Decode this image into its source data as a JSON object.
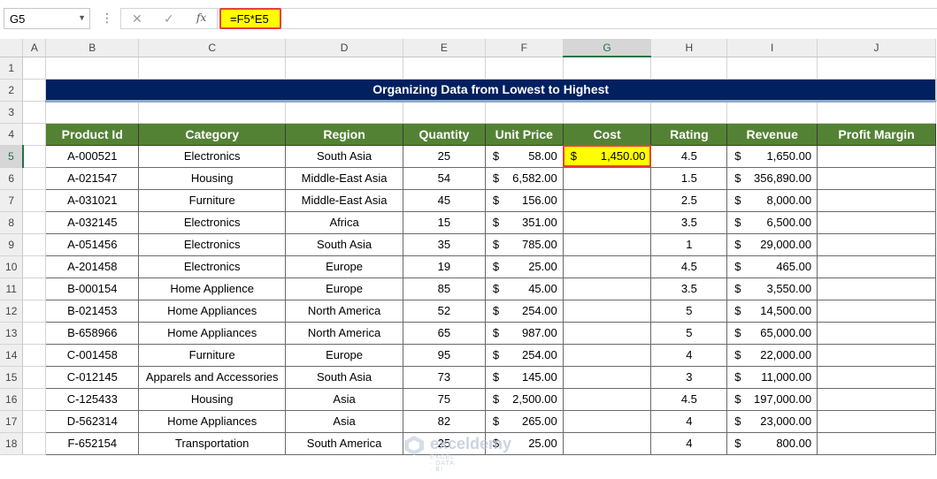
{
  "formula_bar": {
    "name_box": "G5",
    "formula": "=F5*E5",
    "cancel_glyph": "✕",
    "enter_glyph": "✓",
    "fx_label": "fx",
    "menu_glyph": "⋮"
  },
  "columns": [
    "A",
    "B",
    "C",
    "D",
    "E",
    "F",
    "G",
    "H",
    "I",
    "J"
  ],
  "rows": [
    "1",
    "2",
    "3",
    "4",
    "5",
    "6",
    "7",
    "8",
    "9",
    "10",
    "11",
    "12",
    "13",
    "14",
    "15",
    "16",
    "17",
    "18"
  ],
  "selected_cell": {
    "column": "G",
    "row": "5"
  },
  "title": "Organizing Data from Lowest to Highest",
  "headers": [
    "Product Id",
    "Category",
    "Region",
    "Quantity",
    "Unit Price",
    "Cost",
    "Rating",
    "Revenue",
    "Profit Margin"
  ],
  "currency_symbol": "$",
  "data_rows": [
    {
      "id": "A-000521",
      "category": "Electronics",
      "region": "South Asia",
      "qty": "25",
      "price": "58.00",
      "cost": "1,450.00",
      "rating": "4.5",
      "revenue": "1,650.00",
      "margin": ""
    },
    {
      "id": "A-021547",
      "category": "Housing",
      "region": "Middle-East Asia",
      "qty": "54",
      "price": "6,582.00",
      "cost": "",
      "rating": "1.5",
      "revenue": "356,890.00",
      "margin": ""
    },
    {
      "id": "A-031021",
      "category": "Furniture",
      "region": "Middle-East Asia",
      "qty": "45",
      "price": "156.00",
      "cost": "",
      "rating": "2.5",
      "revenue": "8,000.00",
      "margin": ""
    },
    {
      "id": "A-032145",
      "category": "Electronics",
      "region": "Africa",
      "qty": "15",
      "price": "351.00",
      "cost": "",
      "rating": "3.5",
      "revenue": "6,500.00",
      "margin": ""
    },
    {
      "id": "A-051456",
      "category": "Electronics",
      "region": "South Asia",
      "qty": "35",
      "price": "785.00",
      "cost": "",
      "rating": "1",
      "revenue": "29,000.00",
      "margin": ""
    },
    {
      "id": "A-201458",
      "category": "Electronics",
      "region": "Europe",
      "qty": "19",
      "price": "25.00",
      "cost": "",
      "rating": "4.5",
      "revenue": "465.00",
      "margin": ""
    },
    {
      "id": "B-000154",
      "category": "Home Applience",
      "region": "Europe",
      "qty": "85",
      "price": "45.00",
      "cost": "",
      "rating": "3.5",
      "revenue": "3,550.00",
      "margin": ""
    },
    {
      "id": "B-021453",
      "category": "Home Appliances",
      "region": "North America",
      "qty": "52",
      "price": "254.00",
      "cost": "",
      "rating": "5",
      "revenue": "14,500.00",
      "margin": ""
    },
    {
      "id": "B-658966",
      "category": "Home Appliances",
      "region": "North America",
      "qty": "65",
      "price": "987.00",
      "cost": "",
      "rating": "5",
      "revenue": "65,000.00",
      "margin": ""
    },
    {
      "id": "C-001458",
      "category": "Furniture",
      "region": "Europe",
      "qty": "95",
      "price": "254.00",
      "cost": "",
      "rating": "4",
      "revenue": "22,000.00",
      "margin": ""
    },
    {
      "id": "C-012145",
      "category": "Apparels and Accessories",
      "region": "South Asia",
      "qty": "73",
      "price": "145.00",
      "cost": "",
      "rating": "3",
      "revenue": "11,000.00",
      "margin": ""
    },
    {
      "id": "C-125433",
      "category": "Housing",
      "region": "Asia",
      "qty": "75",
      "price": "2,500.00",
      "cost": "",
      "rating": "4.5",
      "revenue": "197,000.00",
      "margin": ""
    },
    {
      "id": "D-562314",
      "category": "Home Appliances",
      "region": "Asia",
      "qty": "82",
      "price": "265.00",
      "cost": "",
      "rating": "4",
      "revenue": "23,000.00",
      "margin": ""
    },
    {
      "id": "F-652154",
      "category": "Transportation",
      "region": "South America",
      "qty": "25",
      "price": "25.00",
      "cost": "",
      "rating": "4",
      "revenue": "800.00",
      "margin": ""
    }
  ],
  "watermark": {
    "name": "exceldemy",
    "tagline": "EXCEL · DATA · BI"
  },
  "colors": {
    "title_bg": "#002060",
    "header_bg": "#548235",
    "highlight": "#ffff00",
    "highlight_border": "#e84040",
    "excel_green": "#217346"
  }
}
